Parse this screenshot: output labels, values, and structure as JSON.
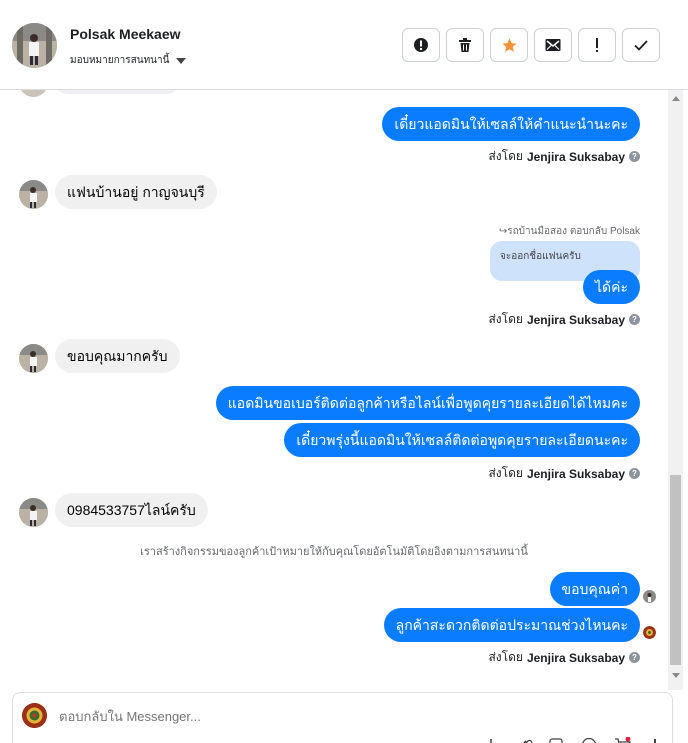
{
  "header": {
    "name": "Polsak Meekaew",
    "assign_label": "มอบหมายการสนทนานี้",
    "actions": [
      "report-icon",
      "trash-icon",
      "star-icon",
      "envelope-icon",
      "exclamation-icon",
      "check-icon"
    ]
  },
  "messages": {
    "m1": "เดี๋ยวแอดมินให้เซลล์ให้คำแนะนำนะคะ",
    "sent_prefix": "ส่งโดย",
    "agent": "Jenjira Suksabay",
    "m2": "แฟนบ้านอยู่ กาญจนบุรี",
    "reply_note": "↪รถบ้านมือสอง ตอบกลับ Polsak",
    "quoted": "จะออกชื่อแฟนครับ",
    "m3": "ได้ค่ะ",
    "m4": "ขอบคุณมากครับ",
    "m5": "แอดมินขอเบอร์ติดต่อลูกค้าหรือไลน์เพื่อพูดคุยรายละเอียดได้ไหมคะ",
    "m6": "เดี๋ยวพรุ่งนี้แอดมินให้เซลล์ติดต่อพูดคุยรายละเอียดนะคะ",
    "m7": "0984533757ไลน์ครับ",
    "system": "เราสร้างกิจกรรมของลูกค้าเป้าหมายให้กับคุณโดยอัตโนมัติโดยอิงตามการสนทนานี้",
    "m8": "ขอบคุณค่า",
    "m9": "ลูกค้าสะดวกติดต่อประมาณช่วงไหนคะ"
  },
  "composer": {
    "placeholder": "ตอบกลับใน Messenger..."
  },
  "colors": {
    "outgoing": "#0a7cff",
    "incoming": "#f0f0f0",
    "quoted": "#cfe2fc"
  }
}
